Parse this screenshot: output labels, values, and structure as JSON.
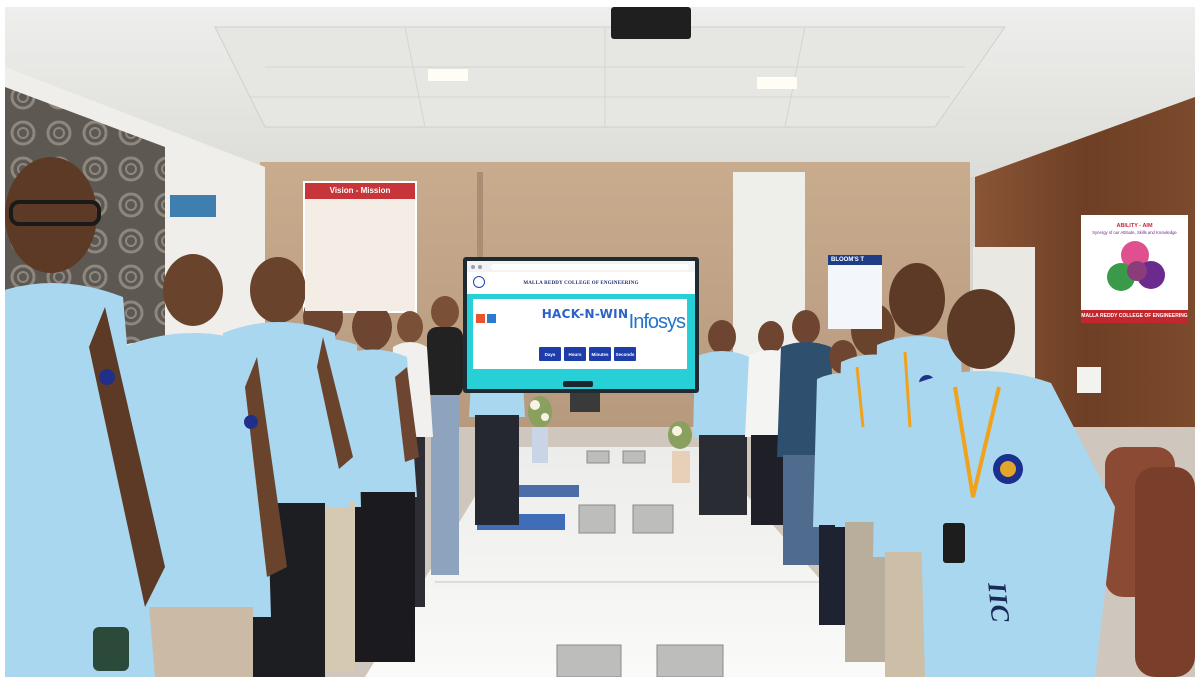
{
  "screen": {
    "college_name": "MALLA REDDY COLLEGE OF ENGINEERING",
    "hackathon_title": "HACK-N-WIN",
    "sponsor_logo": "Infosys",
    "timer_labels": [
      "Days",
      "Hours",
      "Minutes",
      "Seconds"
    ]
  },
  "posters": {
    "vision_mission": "Vision - Mission",
    "blooms": "BLOOM'S T",
    "ability_title": "ABILITY - AIM",
    "ability_subtitle": "Synergy of our Attitude, Skills and Knowledge",
    "ability_footer": "MALLA REDDY COLLEGE OF ENGINEERING"
  },
  "shirt_print": "IIC",
  "colors": {
    "polo_shirt": "#a9d7ef",
    "lanyard": "#f0a21c",
    "screen_background": "#27cfd6",
    "timer_buttons": "#1d3ea8",
    "wood_panel": "#7a4a2e",
    "table_top": "#f6f6f4"
  }
}
